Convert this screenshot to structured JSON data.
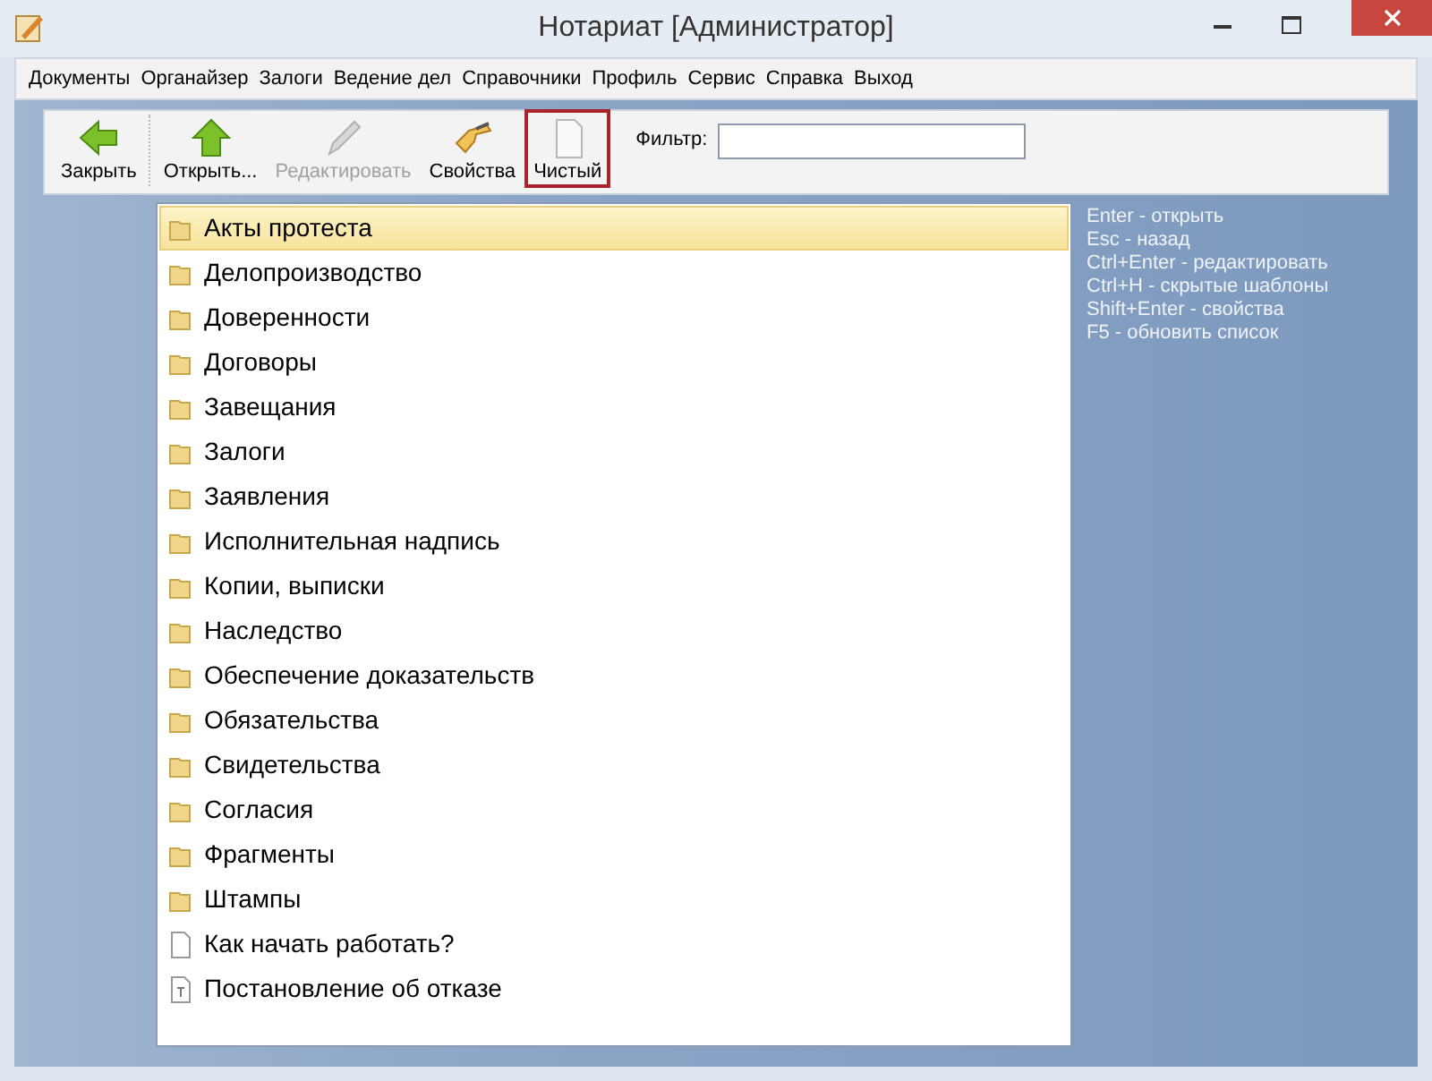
{
  "window": {
    "title": "Нотариат [Администратор]"
  },
  "menu": [
    "Документы",
    "Органайзер",
    "Залоги",
    "Ведение дел",
    "Справочники",
    "Профиль",
    "Сервис",
    "Справка",
    "Выход"
  ],
  "toolbar": [
    {
      "kind": "back",
      "label": "Закрыть",
      "disabled": false,
      "selected": false
    },
    {
      "kind": "up",
      "label": "Открыть...",
      "disabled": false,
      "selected": false
    },
    {
      "kind": "edit",
      "label": "Редактировать",
      "disabled": true,
      "selected": false
    },
    {
      "kind": "properties",
      "label": "Свойства",
      "disabled": false,
      "selected": false
    },
    {
      "kind": "blank",
      "label": "Чистый",
      "disabled": false,
      "selected": true
    }
  ],
  "filter": {
    "label": "Фильтр:"
  },
  "items": [
    {
      "kind": "folder",
      "label": "Акты протеста",
      "selected": true
    },
    {
      "kind": "folder",
      "label": "Делопроизводство",
      "selected": false
    },
    {
      "kind": "folder",
      "label": "Доверенности",
      "selected": false
    },
    {
      "kind": "folder",
      "label": "Договоры",
      "selected": false
    },
    {
      "kind": "folder",
      "label": "Завещания",
      "selected": false
    },
    {
      "kind": "folder",
      "label": "Залоги",
      "selected": false
    },
    {
      "kind": "folder",
      "label": "Заявления",
      "selected": false
    },
    {
      "kind": "folder",
      "label": "Исполнительная надпись",
      "selected": false
    },
    {
      "kind": "folder",
      "label": "Копии, выписки",
      "selected": false
    },
    {
      "kind": "folder",
      "label": "Наследство",
      "selected": false
    },
    {
      "kind": "folder",
      "label": "Обеспечение доказательств",
      "selected": false
    },
    {
      "kind": "folder",
      "label": "Обязательства",
      "selected": false
    },
    {
      "kind": "folder",
      "label": "Свидетельства",
      "selected": false
    },
    {
      "kind": "folder",
      "label": "Согласия",
      "selected": false
    },
    {
      "kind": "folder",
      "label": "Фрагменты",
      "selected": false
    },
    {
      "kind": "folder",
      "label": "Штампы",
      "selected": false
    },
    {
      "kind": "document",
      "label": "Как начать работать?",
      "selected": false
    },
    {
      "kind": "template",
      "label": "Постановление об отказе",
      "selected": false
    }
  ],
  "hints": [
    "Enter - открыть",
    "Esc - назад",
    "Ctrl+Enter - редактировать",
    "Ctrl+H - скрытые шаблоны",
    "Shift+Enter - свойства",
    "F5 - обновить список"
  ]
}
